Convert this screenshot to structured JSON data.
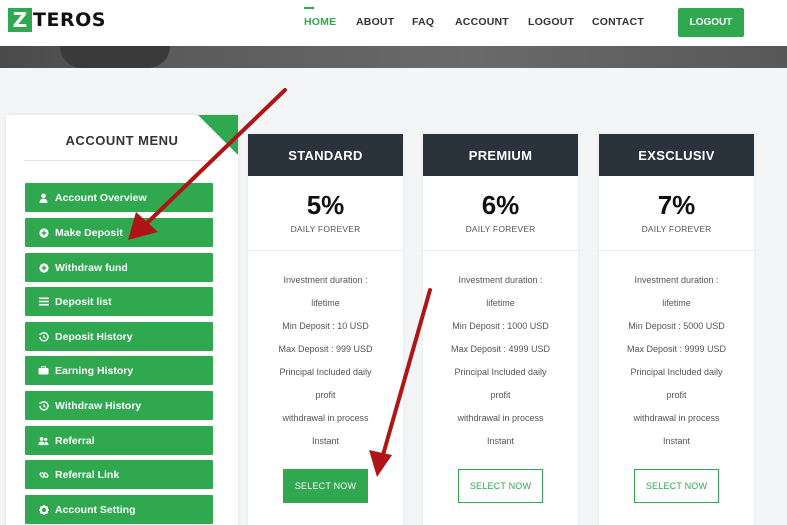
{
  "header": {
    "logo_letter": "Z",
    "logo_text": "TEROS",
    "nav": [
      "HOME",
      "ABOUT",
      "FAQ",
      "ACCOUNT",
      "LOGOUT",
      "CONTACT"
    ],
    "logout_button": "LOGOUT"
  },
  "sidebar": {
    "title": "ACCOUNT MENU",
    "items": [
      {
        "label": "Account Overview",
        "icon": "user-icon"
      },
      {
        "label": "Make Deposit",
        "icon": "plus-circle-icon"
      },
      {
        "label": "Withdraw fund",
        "icon": "plus-circle-icon"
      },
      {
        "label": "Deposit list",
        "icon": "list-icon"
      },
      {
        "label": "Deposit History",
        "icon": "history-icon"
      },
      {
        "label": "Earning History",
        "icon": "briefcase-icon"
      },
      {
        "label": "Withdraw History",
        "icon": "history-icon"
      },
      {
        "label": "Referral",
        "icon": "users-icon"
      },
      {
        "label": "Referral Link",
        "icon": "link-icon"
      },
      {
        "label": "Account Setting",
        "icon": "gear-icon"
      }
    ]
  },
  "plans": [
    {
      "name": "STANDARD",
      "rate": "5%",
      "rate_sub": "DAILY FOREVER",
      "lines": [
        "Investment duration :",
        "lifetime",
        "Min Deposit : 10 USD",
        "Max Deposit : 999 USD",
        "Principal Included daily",
        "profit",
        "withdrawal in process",
        "Instant"
      ],
      "button": "SELECT NOW",
      "button_style": "filled"
    },
    {
      "name": "PREMIUM",
      "rate": "6%",
      "rate_sub": "DAILY FOREVER",
      "lines": [
        "Investment duration :",
        "lifetime",
        "Min Deposit : 1000 USD",
        "Max Deposit : 4999 USD",
        "Principal Included daily",
        "profit",
        "withdrawal in process",
        "Instant"
      ],
      "button": "SELECT NOW",
      "button_style": "outline"
    },
    {
      "name": "EXSCLUSIV",
      "rate": "7%",
      "rate_sub": "DAILY FOREVER",
      "lines": [
        "Investment duration :",
        "lifetime",
        "Min Deposit : 5000 USD",
        "Max Deposit : 9999 USD",
        "Principal Included daily",
        "profit",
        "withdrawal in process",
        "Instant"
      ],
      "button": "SELECT NOW",
      "button_style": "outline"
    }
  ],
  "colors": {
    "accent": "#2fa84f",
    "card_header": "#2a323c",
    "annotation_arrow": "#b01515"
  }
}
